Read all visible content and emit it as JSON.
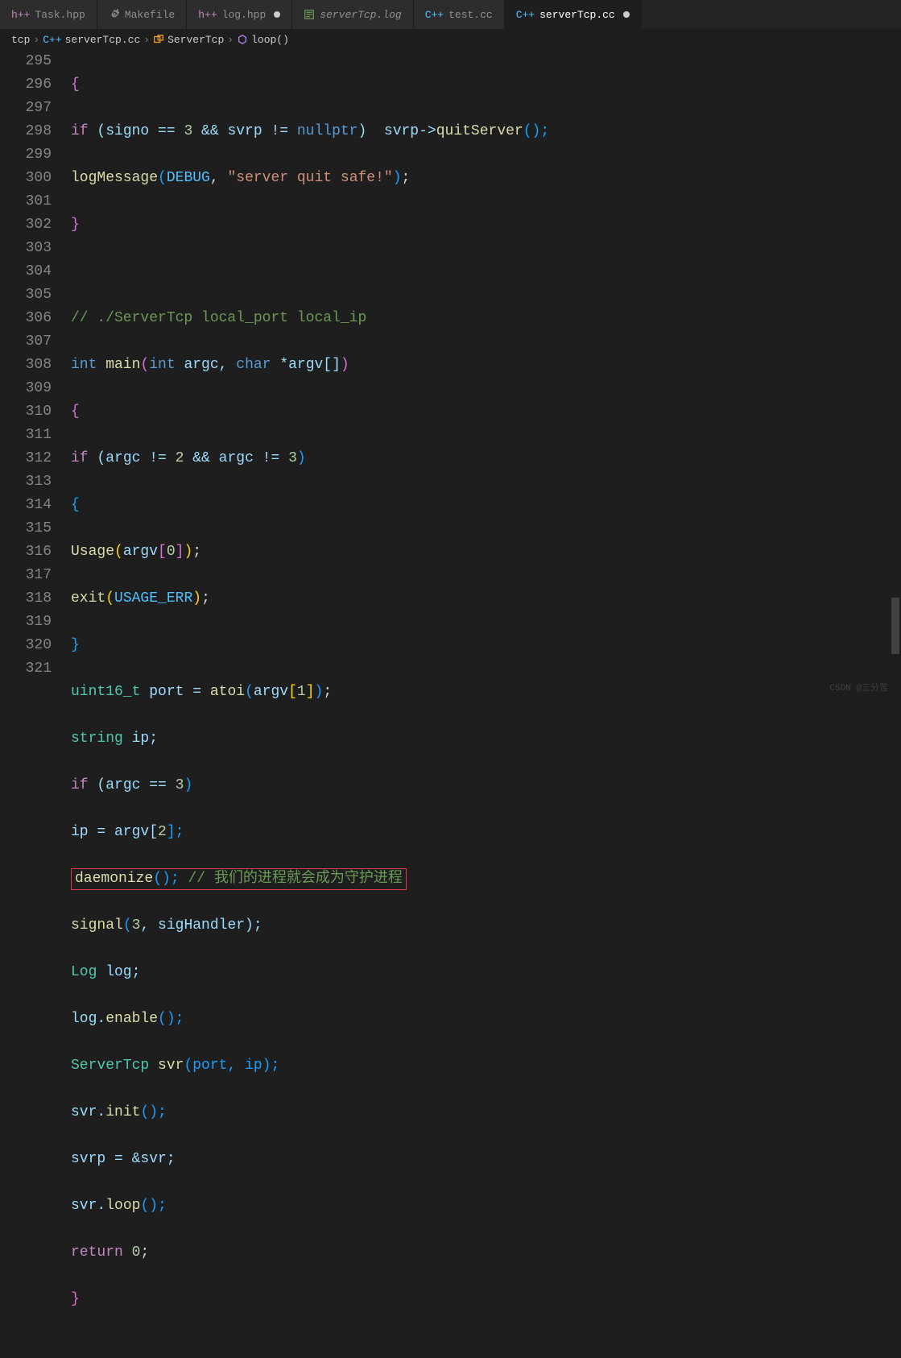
{
  "tabs": [
    {
      "label": "Task.hpp",
      "icon": "h++",
      "iconClass": "ic-pink",
      "active": false,
      "dirty": false
    },
    {
      "label": "Makefile",
      "icon": "cog",
      "iconClass": "",
      "active": false,
      "dirty": false
    },
    {
      "label": "log.hpp",
      "icon": "h++",
      "iconClass": "ic-pink",
      "active": false,
      "dirty": true
    },
    {
      "label": "serverTcp.log",
      "icon": "log",
      "iconClass": "ic-green",
      "active": false,
      "italic": true,
      "dirty": false
    },
    {
      "label": "test.cc",
      "icon": "C++",
      "iconClass": "ic-blue",
      "active": false,
      "dirty": false
    },
    {
      "label": "serverTcp.cc",
      "icon": "C++",
      "iconClass": "ic-blue",
      "active": true,
      "dirty": true
    }
  ],
  "breadcrumbs": {
    "items": [
      {
        "label": "tcp",
        "icon": ""
      },
      {
        "label": "serverTcp.cc",
        "icon": "C++"
      },
      {
        "label": "ServerTcp",
        "icon": "class"
      },
      {
        "label": "loop()",
        "icon": "method"
      }
    ]
  },
  "lines": {
    "start": 295,
    "end": 321
  },
  "code": {
    "l295": "{",
    "l296a": "if",
    "l296b": " (signo == ",
    "l296c": "3",
    "l296d": " && svrp != ",
    "l296e": "nullptr",
    "l296f": ")  svrp->",
    "l296g": "quitServer",
    "l296h": "();",
    "l297a": "logMessage",
    "l297b": "(DEBUG, ",
    "l297c": "\"server quit safe!\"",
    "l297d": ");",
    "l298": "}",
    "l300": "// ./ServerTcp local_port local_ip",
    "l301a": "int",
    "l301b": " main",
    "l301c": "int",
    "l301d": " argc, ",
    "l301e": "char",
    "l301f": " *argv[]",
    "l302": "{",
    "l303a": "if",
    "l303b": " (argc != ",
    "l303c": "2",
    "l303d": " && argc != ",
    "l303e": "3",
    "l303f": ")",
    "l304": "{",
    "l305a": "Usage",
    "l305b": "(argv[",
    "l305c": "0",
    "l305d": "]);",
    "l306a": "exit",
    "l306b": "(USAGE_ERR);",
    "l307": "}",
    "l308a": "uint16_t",
    "l308b": " port = ",
    "l308c": "atoi",
    "l308d": "(argv[",
    "l308e": "1",
    "l308f": "]);",
    "l309a": "string",
    "l309b": " ip;",
    "l310a": "if",
    "l310b": " (argc == ",
    "l310c": "3",
    "l310d": ")",
    "l311a": "ip = argv[",
    "l311b": "2",
    "l311c": "];",
    "l312a": "daemonize",
    "l312b": "(); ",
    "l312c": "// 我们的进程就会成为守护进程",
    "l313a": "signal",
    "l313b": "(",
    "l313c": "3",
    "l313d": ", sigHandler);",
    "l314a": "Log",
    "l314b": " log;",
    "l315a": "log.",
    "l315b": "enable",
    "l315c": "();",
    "l316a": "ServerTcp",
    "l316b": " svr",
    "l316c": "(port, ip);",
    "l317a": "svr.",
    "l317b": "init",
    "l317c": "();",
    "l318": "svrp = &svr;",
    "l319a": "svr.",
    "l319b": "loop",
    "l319c": "();",
    "l320a": "return",
    "l320b": " 0",
    "l320c": ";",
    "l321": "}"
  },
  "watermark": "CSDN @三分苦"
}
